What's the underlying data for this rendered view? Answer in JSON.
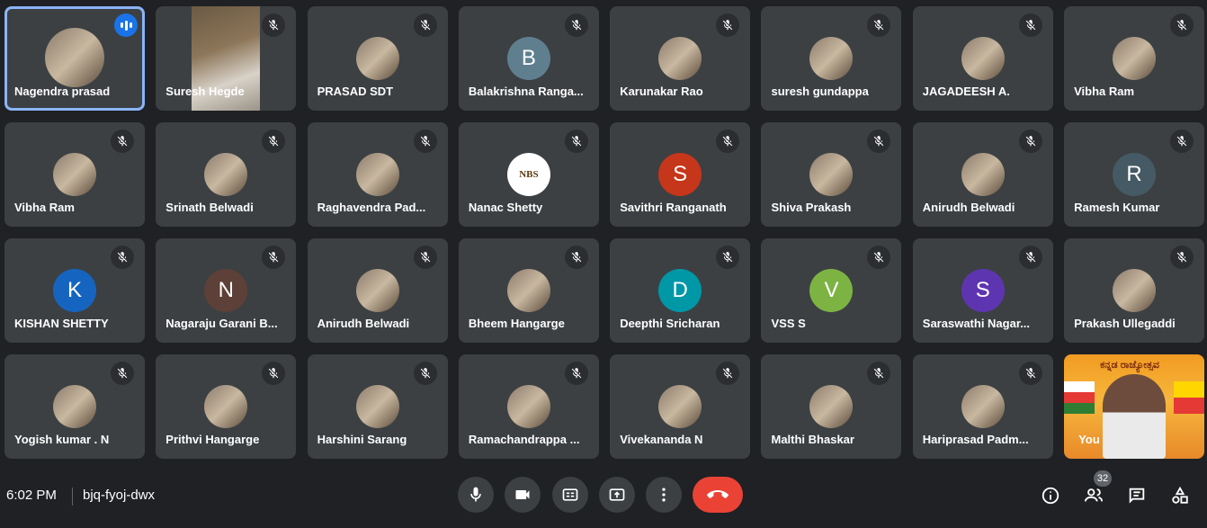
{
  "participants": [
    {
      "name": "Nagendra prasad",
      "avatar": "photo",
      "speaking": true
    },
    {
      "name": "Suresh Hegde",
      "avatar": "video"
    },
    {
      "name": "PRASAD SDT",
      "avatar": "photo"
    },
    {
      "name": "Balakrishna Ranga...",
      "avatar": "letter",
      "letter": "B",
      "color": "#5f7f8f"
    },
    {
      "name": "Karunakar Rao",
      "avatar": "photo"
    },
    {
      "name": "suresh gundappa",
      "avatar": "photo"
    },
    {
      "name": "JAGADEESH A.",
      "avatar": "photo"
    },
    {
      "name": "Vibha Ram",
      "avatar": "photo"
    },
    {
      "name": "Vibha Ram",
      "avatar": "photo"
    },
    {
      "name": "Srinath Belwadi",
      "avatar": "photo"
    },
    {
      "name": "Raghavendra Pad...",
      "avatar": "photo"
    },
    {
      "name": "Nanac Shetty",
      "avatar": "logo",
      "letter": "NBS"
    },
    {
      "name": "Savithri Ranganath",
      "avatar": "letter",
      "letter": "S",
      "color": "#c5361a"
    },
    {
      "name": "Shiva Prakash",
      "avatar": "photo"
    },
    {
      "name": "Anirudh Belwadi",
      "avatar": "photo"
    },
    {
      "name": "Ramesh Kumar",
      "avatar": "letter",
      "letter": "R",
      "color": "#455a64"
    },
    {
      "name": "KISHAN SHETTY",
      "avatar": "letter",
      "letter": "K",
      "color": "#1565c0"
    },
    {
      "name": "Nagaraju Garani B...",
      "avatar": "letter",
      "letter": "N",
      "color": "#5d4037"
    },
    {
      "name": "Anirudh Belwadi",
      "avatar": "photo"
    },
    {
      "name": "Bheem Hangarge",
      "avatar": "photo"
    },
    {
      "name": "Deepthi Sricharan",
      "avatar": "letter",
      "letter": "D",
      "color": "#0097a7"
    },
    {
      "name": "VSS S",
      "avatar": "letter",
      "letter": "V",
      "color": "#7cb342"
    },
    {
      "name": "Saraswathi Nagar...",
      "avatar": "letter",
      "letter": "S",
      "color": "#5e35b1"
    },
    {
      "name": "Prakash Ullegaddi",
      "avatar": "photo"
    },
    {
      "name": "Yogish kumar . N",
      "avatar": "photo"
    },
    {
      "name": "Prithvi Hangarge",
      "avatar": "photo"
    },
    {
      "name": "Harshini Sarang",
      "avatar": "photo"
    },
    {
      "name": "Ramachandrappa ...",
      "avatar": "photo"
    },
    {
      "name": "Vivekananda N",
      "avatar": "photo"
    },
    {
      "name": "Malthi Bhaskar",
      "avatar": "photo"
    },
    {
      "name": "Hariprasad Padm...",
      "avatar": "photo"
    },
    {
      "name": "You",
      "avatar": "self"
    }
  ],
  "self_tile": {
    "label": "You",
    "banner": "ಕನ್ನಡ ರಾಜ್ಯೋತ್ಸವ"
  },
  "meeting": {
    "time": "6:02 PM",
    "code": "bjq-fyoj-dwx"
  },
  "controls": {
    "mic": "mic-icon",
    "camera": "camera-icon",
    "captions": "captions-icon",
    "present": "present-icon",
    "more": "more-vert-icon",
    "leave": "hangup-icon"
  },
  "side": {
    "participant_count": "32"
  },
  "colors": {
    "background": "#202124",
    "tile": "#3c4043",
    "speaking": "#8ab4f8",
    "leave": "#ea4335"
  }
}
